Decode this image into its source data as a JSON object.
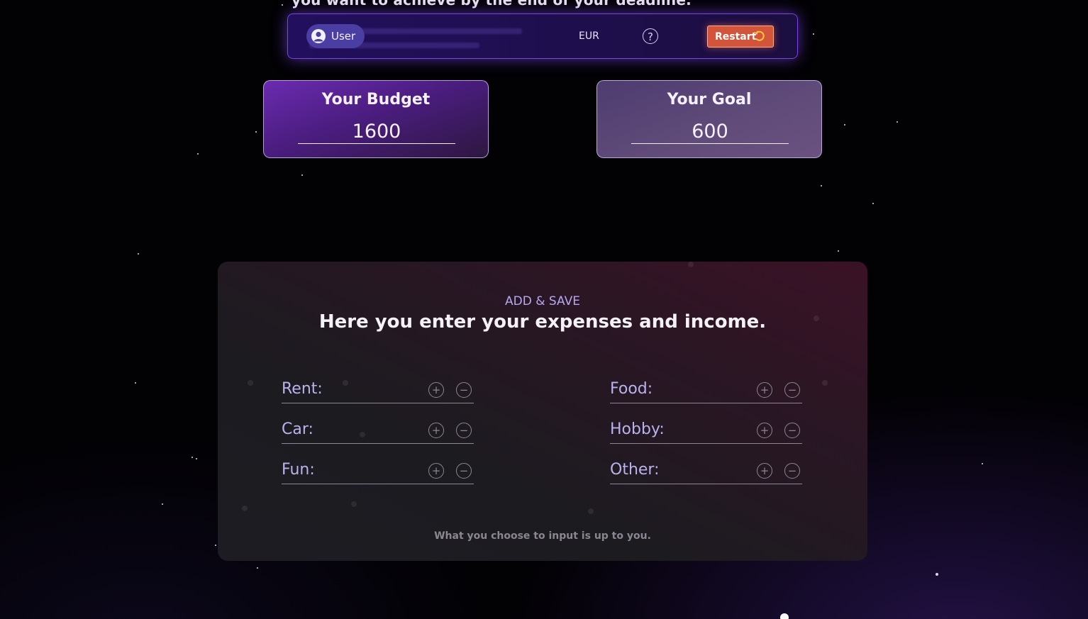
{
  "intro": {
    "text": "you want to achieve by the end of your deadline."
  },
  "toolbar": {
    "user_label": "User",
    "currency": "EUR",
    "help_symbol": "?",
    "restart_label": "Restart",
    "restart_icon": "restart-icon"
  },
  "budget": {
    "title": "Your Budget",
    "value": "1600"
  },
  "goal": {
    "title": "Your Goal",
    "value": "600"
  },
  "add_save": {
    "kicker": "ADD & SAVE",
    "heading": "Here you enter your expenses and income.",
    "footer": "What you choose to input is up to you.",
    "plus_symbol": "+",
    "minus_symbol": "−",
    "fields": [
      {
        "label": "Rent:"
      },
      {
        "label": "Food:"
      },
      {
        "label": "Car:"
      },
      {
        "label": "Hobby:"
      },
      {
        "label": "Fun:"
      },
      {
        "label": "Other:"
      }
    ]
  }
}
